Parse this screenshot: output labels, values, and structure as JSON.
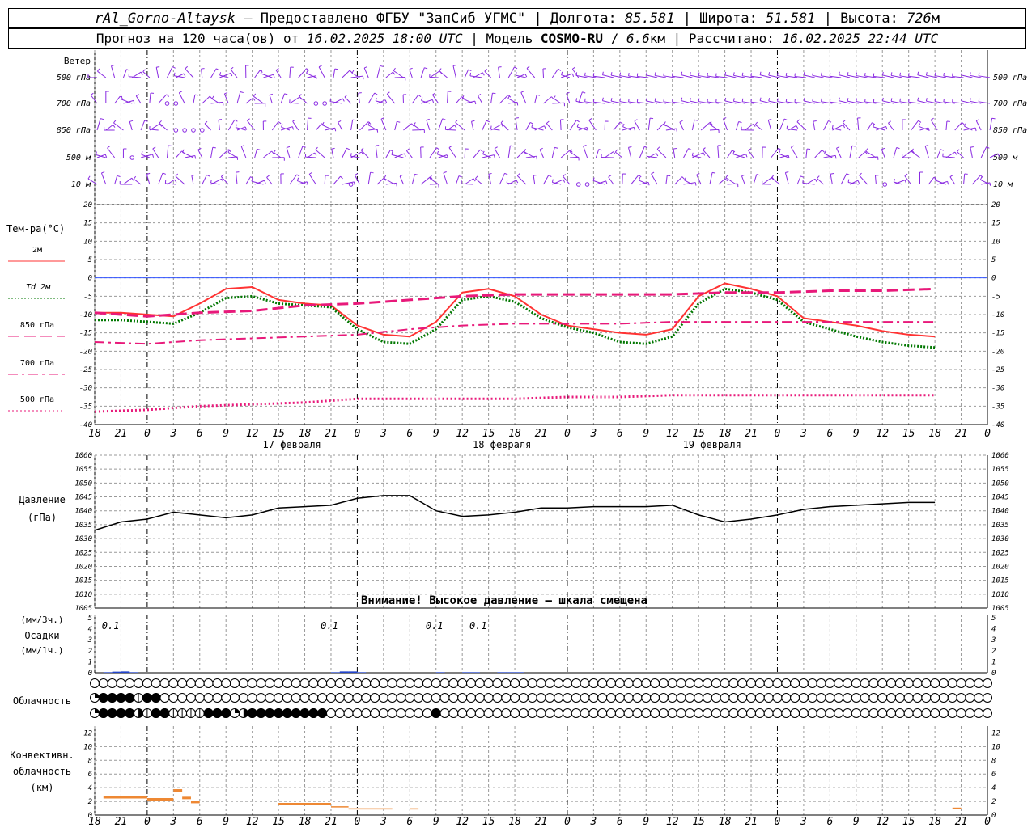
{
  "header": {
    "station": "rAl_Gorno-Altaysk",
    "sep1": " – ",
    "provider": "Предоставлено ФГБУ \"ЗапСиб УГМС\"",
    "lon_label": " | Долгота: ",
    "lon": "85.581",
    "lat_label": " | Широта: ",
    "lat": "51.581",
    "alt_label": " | Высота: ",
    "alt": "726",
    "alt_unit": "м",
    "forecast_label": "Прогноз на 120 часа(ов) от ",
    "forecast_from": "16.02.2025 18:00 UTC",
    "model_label": "  | Модель ",
    "model": "COSMO-RU",
    "sep_model": " / ",
    "resolution": "6.6",
    "res_unit": "км",
    "computed_label": " | Рассчитано: ",
    "computed": "16.02.2025 22:44 UTC"
  },
  "labels": {
    "wind": "Ветер",
    "wind_levels": [
      "500 гПа",
      "700 гПа",
      "850 гПа",
      "500 м",
      "10  м"
    ],
    "temp_title": "Тем-ра(°C)",
    "temp_legend": [
      "2м",
      "Td  2м",
      "850 гПа",
      "700 гПа",
      "500 гПа"
    ],
    "pressure_title": "Давление",
    "pressure_unit": "(гПа)",
    "pressure_warning": "Внимание! Высокое давление – шкала смещена",
    "precip_unit_top": "(мм/3ч.)",
    "precip_title": "Осадки",
    "precip_unit_bottom": "(мм/1ч.)",
    "precip_labels": [
      "0.1",
      "0.1",
      "0.1",
      "0.1"
    ],
    "cloud_title": "Облачность",
    "conv_title_1": "Конвективн.",
    "conv_title_2": "облачность",
    "conv_unit": "(км)"
  },
  "colors": {
    "t2m": "#ff3333",
    "td2m": "#007700",
    "t850": "#e8197a",
    "t700": "#e8197a",
    "t500": "#e8197a",
    "wind": "#8a2be2",
    "zero_line": "#3355ff",
    "pressure": "#000000",
    "precip": "#2244cc",
    "conv": "#ee8833",
    "grid": "#999999"
  },
  "chart_data": {
    "type": "line",
    "x_hours_utc": [
      "18",
      "21",
      "0",
      "3",
      "6",
      "9",
      "12",
      "15",
      "18",
      "21",
      "0",
      "3",
      "6",
      "9",
      "12",
      "15",
      "18",
      "21",
      "0",
      "3",
      "6",
      "9",
      "12",
      "15",
      "18",
      "21",
      "0",
      "3",
      "6",
      "9",
      "12",
      "15",
      "18",
      "21",
      "0"
    ],
    "dates": [
      "17 февраля",
      "18 февраля",
      "19 февраля"
    ],
    "temperature": {
      "ylim": [
        -40,
        20
      ],
      "yticks": [
        20,
        15,
        10,
        5,
        0,
        -5,
        -10,
        -15,
        -20,
        -25,
        -30,
        -35,
        -40
      ],
      "series": [
        {
          "name": "2м",
          "step_hours": 3,
          "values": [
            -9.5,
            -9.5,
            -10,
            -10.5,
            -7,
            -3,
            -2.5,
            -6,
            -7,
            -7.5,
            -13,
            -15.5,
            -16,
            -12,
            -4,
            -3,
            -5,
            -10,
            -13,
            -14,
            -15,
            -15.5,
            -14,
            -5,
            -1.5,
            -3,
            -5,
            -11,
            -12,
            -13,
            -14.5,
            -15.5,
            -16
          ]
        },
        {
          "name": "Td 2м",
          "step_hours": 3,
          "values": [
            -11.5,
            -11.5,
            -12,
            -12.5,
            -9.5,
            -5.5,
            -5,
            -7,
            -7.5,
            -8,
            -14,
            -17.5,
            -18,
            -14,
            -6,
            -5,
            -6.5,
            -11,
            -13.5,
            -15,
            -17.5,
            -18,
            -16,
            -7,
            -3,
            -4,
            -6,
            -12,
            -14,
            -16,
            -17.5,
            -18.5,
            -19
          ]
        },
        {
          "name": "850 гПа",
          "step_hours": 6,
          "values": [
            -9.5,
            -10.5,
            -9.5,
            -9,
            -7.5,
            -7,
            -6,
            -5,
            -4.5,
            -4.5,
            -4.5,
            -4.5,
            -4,
            -4,
            -3.5,
            -3.5,
            -3
          ]
        },
        {
          "name": "700 гПа",
          "step_hours": 6,
          "values": [
            -17.5,
            -18,
            -17,
            -16.5,
            -16,
            -15.5,
            -14,
            -13,
            -12.5,
            -12.5,
            -12.5,
            -12,
            -12,
            -12,
            -12,
            -12,
            -12
          ]
        },
        {
          "name": "500 гПа",
          "step_hours": 6,
          "values": [
            -36.5,
            -36,
            -35,
            -34.5,
            -34,
            -33,
            -33,
            -33,
            -33,
            -32.5,
            -32.5,
            -32,
            -32,
            -32,
            -32,
            -32,
            -32
          ]
        }
      ]
    },
    "pressure": {
      "ylim": [
        1005,
        1060
      ],
      "yticks": [
        1060,
        1055,
        1050,
        1045,
        1040,
        1035,
        1030,
        1025,
        1020,
        1015,
        1010,
        1005
      ],
      "step_hours": 3,
      "values": [
        1033,
        1036,
        1037,
        1039.5,
        1038.5,
        1037.5,
        1038.5,
        1041,
        1041.5,
        1042,
        1044.5,
        1045.5,
        1045.5,
        1040,
        1038,
        1038.5,
        1039.5,
        1041,
        1041,
        1041.5,
        1041.5,
        1041.5,
        1042,
        1038.5,
        1036,
        1037,
        1038.5,
        1040.5,
        1041.5,
        1042,
        1042.5,
        1043,
        1043
      ]
    },
    "precipitation": {
      "ylim": [
        0,
        5
      ],
      "yticks": [
        5,
        4,
        3,
        2,
        1,
        0
      ],
      "step_hours": 1,
      "values": [
        0,
        0.05,
        0.1,
        0.12,
        0.05,
        0,
        0,
        0,
        0,
        0,
        0,
        0,
        0,
        0,
        0,
        0,
        0,
        0,
        0,
        0,
        0,
        0,
        0,
        0,
        0,
        0,
        0,
        0.05,
        0.12,
        0.12,
        0.05,
        0,
        0,
        0,
        0,
        0,
        0,
        0,
        0,
        0.05,
        0,
        0,
        0.05,
        0.05,
        0,
        0,
        0.05,
        0.05,
        0.05,
        0,
        0,
        0
      ]
    },
    "cloudiness": {
      "rows": 3,
      "step_hours": 1,
      "top": "0000000000000000000000000000000000000000000000000000000000000000000000000000000000000000000000000000000000000000000",
      "middle": "5888848800000000000000000000000000000000000000000000000000000000000000000000000000000000000000000000000000000000000",
      "bottom": "5888864884444888568888888880000000000008000000000000000000000000000000000000000000000000000000000000000000000000"
    },
    "convective": {
      "ylim": [
        0,
        13
      ],
      "yticks": [
        12,
        10,
        8,
        6,
        4,
        2,
        0
      ],
      "segments": [
        {
          "start_hour": 1,
          "end_hour": 6,
          "value": 2.6
        },
        {
          "start_hour": 6,
          "end_hour": 9,
          "value": 2.3
        },
        {
          "start_hour": 9,
          "end_hour": 10,
          "value": 3.6
        },
        {
          "start_hour": 10,
          "end_hour": 11,
          "value": 2.5
        },
        {
          "start_hour": 11,
          "end_hour": 12,
          "value": 1.9
        },
        {
          "start_hour": 21,
          "end_hour": 27,
          "value": 1.6
        },
        {
          "start_hour": 27,
          "end_hour": 29,
          "value": 1.2
        },
        {
          "start_hour": 29,
          "end_hour": 34,
          "value": 0.9
        },
        {
          "start_hour": 36,
          "end_hour": 37,
          "value": 0.9
        },
        {
          "start_hour": 98,
          "end_hour": 99,
          "value": 1.0
        }
      ]
    }
  }
}
